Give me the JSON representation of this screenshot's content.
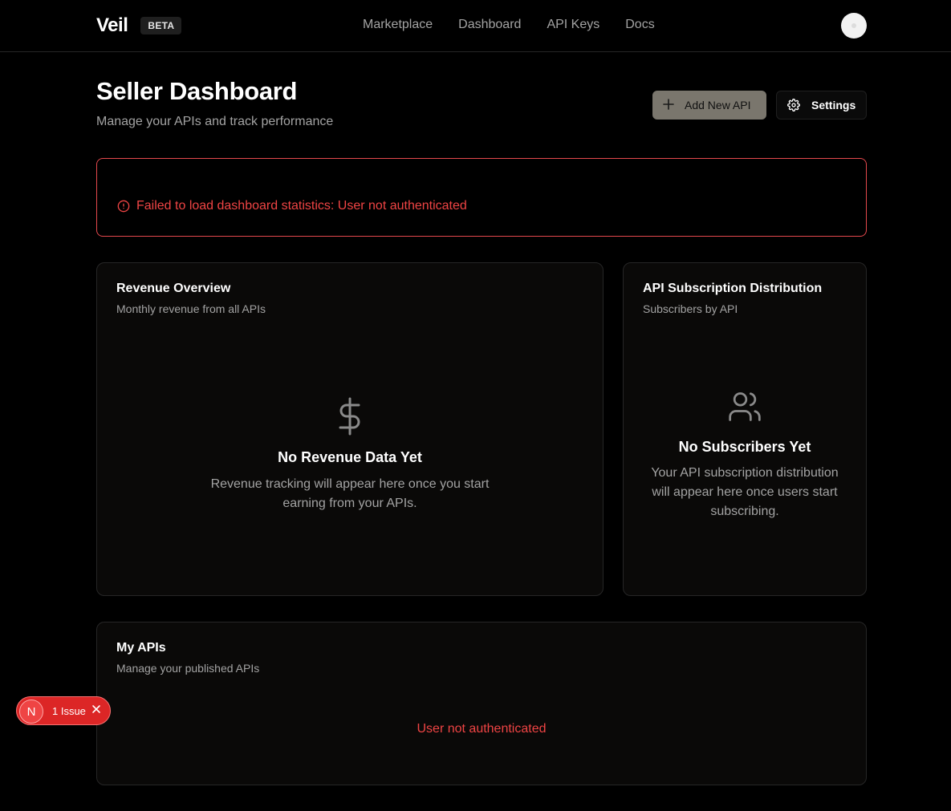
{
  "brand": {
    "name": "Veil",
    "badge": "BETA"
  },
  "nav": {
    "items": [
      {
        "label": "Marketplace"
      },
      {
        "label": "Dashboard"
      },
      {
        "label": "API Keys"
      },
      {
        "label": "Docs"
      }
    ]
  },
  "header": {
    "title": "Seller Dashboard",
    "subtitle": "Manage your APIs and track performance",
    "add_button": "Add New API",
    "settings_button": "Settings"
  },
  "error_banner": {
    "message": "Failed to load dashboard statistics: User not authenticated"
  },
  "revenue_card": {
    "title": "Revenue Overview",
    "description": "Monthly revenue from all APIs",
    "empty_title": "No Revenue Data Yet",
    "empty_line1": "Revenue tracking will appear here once you start",
    "empty_line2": "earning from your APIs."
  },
  "subscription_card": {
    "title": "API Subscription Distribution",
    "description": "Subscribers by API",
    "empty_title": "No Subscribers Yet",
    "empty_line1": "Your API subscription distribution",
    "empty_line2": "will appear here once users start",
    "empty_line3": "subscribing."
  },
  "my_apis_card": {
    "title": "My APIs",
    "description": "Manage your published APIs",
    "error": "User not authenticated"
  },
  "issue_indicator": {
    "logo": "N",
    "label": "1 Issue"
  },
  "colors": {
    "background": "#000000",
    "error": "#ef4444",
    "accent_button": "#7a766d"
  },
  "icons": [
    "plus-icon",
    "gear-icon",
    "alert-circle-icon",
    "dollar-icon",
    "users-icon",
    "close-icon"
  ]
}
